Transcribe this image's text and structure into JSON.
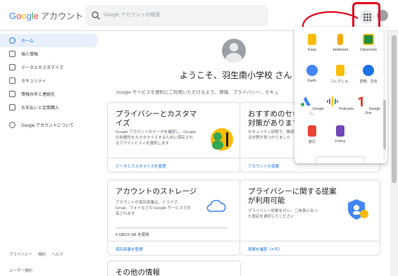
{
  "header": {
    "logo_letters": [
      "G",
      "o",
      "o",
      "g",
      "l",
      "e"
    ],
    "logo_suffix": "アカウント",
    "search_placeholder": "Google アカウントの検索"
  },
  "sidebar": {
    "items": [
      {
        "label": "ホーム",
        "icon": "home-icon",
        "active": true
      },
      {
        "label": "個人情報",
        "icon": "id-card-icon"
      },
      {
        "label": "データとカスタマイズ",
        "icon": "toggle-icon"
      },
      {
        "label": "セキュリティ",
        "icon": "lock-icon"
      },
      {
        "label": "情報共有と連絡先",
        "icon": "people-icon"
      },
      {
        "label": "お支払いと定期購入",
        "icon": "credit-card-icon"
      },
      {
        "label": "Google アカウントについて",
        "icon": "info-icon"
      }
    ],
    "footer_links": [
      "プライバシー",
      "規約",
      "ヘルプ"
    ],
    "footer_terms": "ユーザー規約"
  },
  "main": {
    "welcome": "ようこそ、羽生南小学校 さん",
    "subtitle": "Google サービスを便利にご利用いただけるよう、情報、プライバシー、セキュ",
    "cards": {
      "privacy": {
        "title": "プライバシーとカスタマイズ",
        "desc": "Google アカウントのデータを確認し、Google の利便性をカスタマイズするために保存されるアクティビティを選択します",
        "link": "データとカスタマイズを管理"
      },
      "security": {
        "title": "おすすめのセキュリティ対策があります",
        "desc": "セキュリティ診断で、推奨される対策が見つかりました",
        "link": "アカウントの保護"
      },
      "storage": {
        "title": "アカウントのストレージ",
        "desc": "アカウントの保存容量は、ドライブ、Gmail、フォトなどの Google サービスで共有されます",
        "usage": "0 GB/15 GB を使用",
        "link": "保存容量を管理"
      },
      "privacy_suggest": {
        "title": "プライバシーに関する提案が利用可能",
        "desc": "プライバシー診断を行い、ご自身に合った設定を選択してください",
        "link": "提案を確認（4 件）"
      },
      "other": {
        "title": "その他の情報"
      }
    }
  },
  "apps": [
    {
      "label": "Keep",
      "icon": "keep-icon",
      "color": "#fbbc04"
    },
    {
      "label": "Jamboard",
      "icon": "jamboard-icon",
      "color": "#f9ab00"
    },
    {
      "label": "Classroom",
      "icon": "classroom-icon",
      "color": "#1e8e3e"
    },
    {
      "label": "Earth",
      "icon": "earth-icon",
      "color": "#4285f4"
    },
    {
      "label": "コレクショ..",
      "icon": "collections-icon",
      "color": "#fbbc04"
    },
    {
      "label": "芸術、文化",
      "icon": "arts-culture-icon",
      "color": "#1a73e8"
    },
    {
      "label": "Google ⓒ..",
      "icon": "ads-icon",
      "color": "#4285f4"
    },
    {
      "label": "Podcasts",
      "icon": "podcasts-icon",
      "color": "#34a853"
    },
    {
      "label": "Google One",
      "icon": "google-one-icon",
      "color": "#ea4335"
    },
    {
      "label": "旅行",
      "icon": "travel-icon",
      "color": "#ea4335"
    },
    {
      "label": "Forms",
      "icon": "forms-icon",
      "color": "#7248b9"
    }
  ]
}
